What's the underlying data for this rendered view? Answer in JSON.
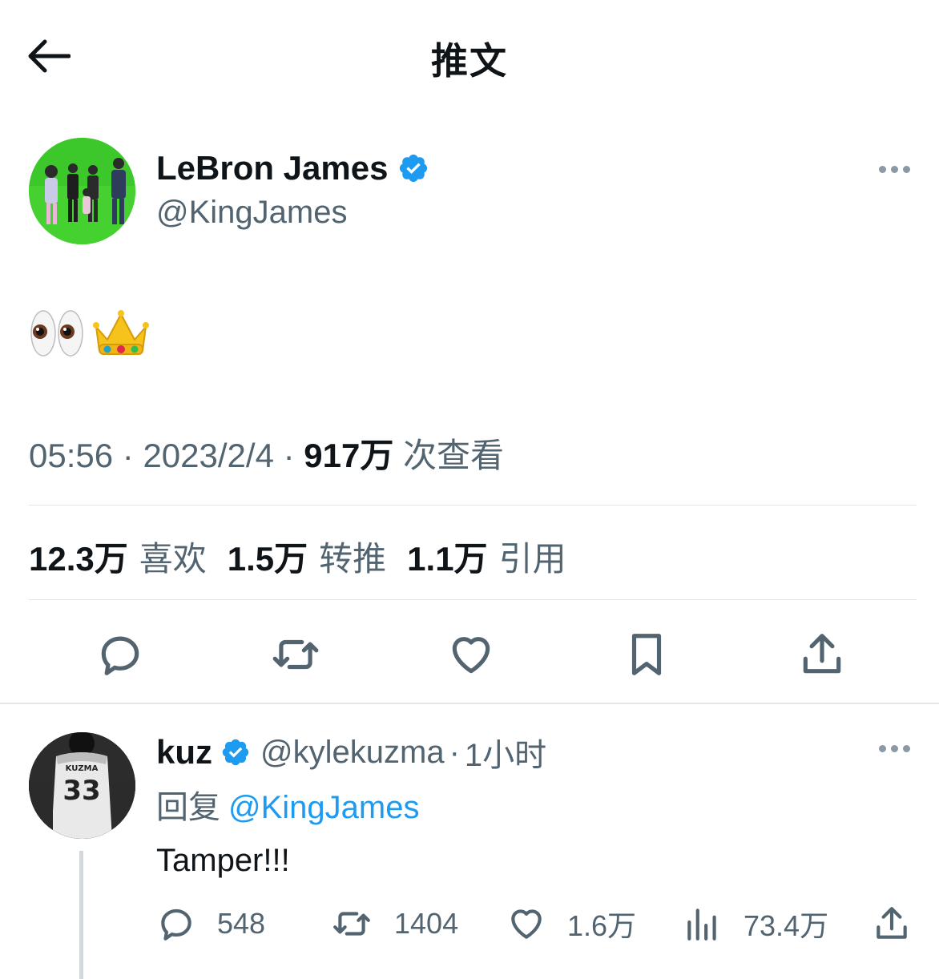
{
  "header": {
    "title": "推文"
  },
  "tweet": {
    "author_name": "LeBron James",
    "author_handle": "@KingJames",
    "time": "05:56",
    "separator": "·",
    "date": "2023/2/4",
    "views_count": "917万",
    "views_label": "次查看",
    "stats": {
      "likes_count": "12.3万",
      "likes_label": "喜欢",
      "retweets_count": "1.5万",
      "retweets_label": "转推",
      "quotes_count": "1.1万",
      "quotes_label": "引用"
    },
    "emoji": [
      "eyes-emoji",
      "crown-emoji"
    ]
  },
  "reply": {
    "author_name": "kuz",
    "author_handle": "@kylekuzma",
    "separator": "·",
    "time": "1小时",
    "reply_to_label": "回复",
    "reply_to_handle": "@KingJames",
    "text": "Tamper!!!",
    "jersey_text": "KUZMA",
    "jersey_number": "33",
    "replies": "548",
    "retweets": "1404",
    "likes": "1.6万",
    "views": "73.4万"
  },
  "colors": {
    "accent": "#1d9bf0",
    "text": "#0f1419",
    "muted": "#536471",
    "divider": "#e1e6ea"
  }
}
